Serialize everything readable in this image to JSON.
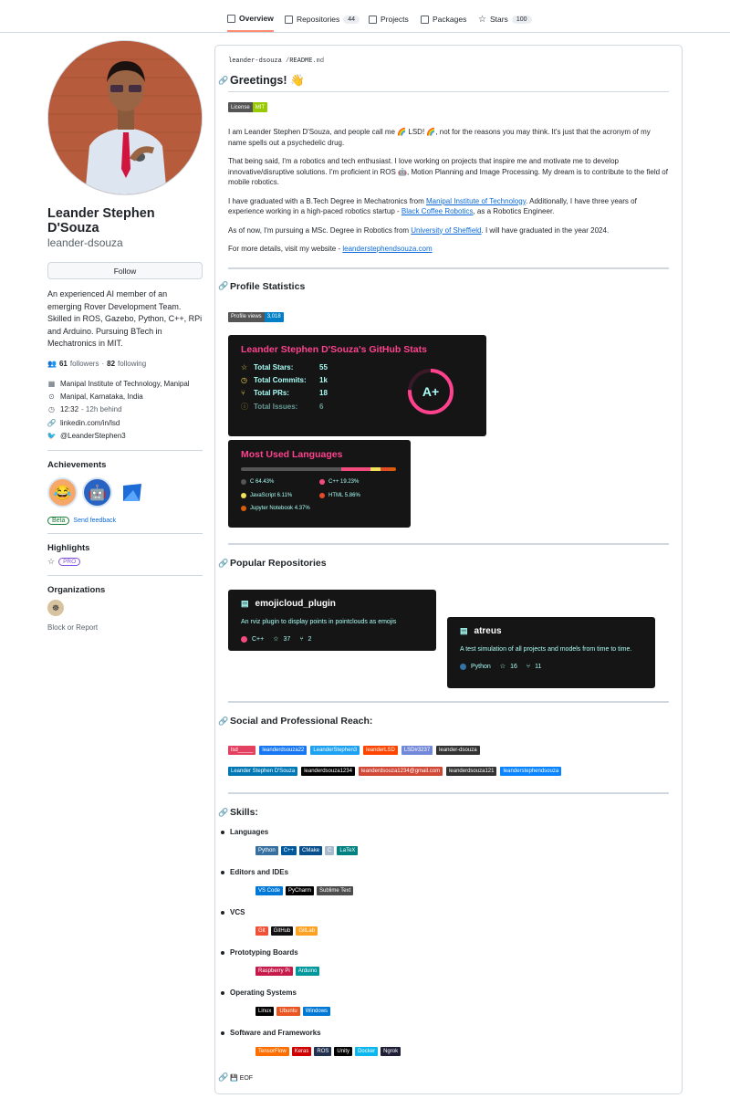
{
  "nav": {
    "tabs": [
      {
        "label": "Overview",
        "icon": "book-icon"
      },
      {
        "label": "Repositories",
        "count": "44",
        "icon": "repo-icon"
      },
      {
        "label": "Projects",
        "icon": "table-icon"
      },
      {
        "label": "Packages",
        "icon": "package-icon"
      },
      {
        "label": "Stars",
        "count": "100",
        "icon": "star-icon"
      }
    ]
  },
  "profile": {
    "name": "Leander Stephen D'Souza",
    "login": "leander-dsouza",
    "follow_label": "Follow",
    "bio": "An experienced AI member of an emerging Rover Development Team. Skilled in ROS, Gazebo, Python, C++, RPi and Arduino. Pursuing BTech in Mechatronics in MIT.",
    "followers": "61",
    "followers_label": "followers",
    "following": "82",
    "following_label": "following",
    "separator": "·",
    "org": "Manipal Institute of Technology, Manipal",
    "location": "Manipal, Karnataka, India",
    "time": "12:32",
    "time_note": "- 12h behind",
    "website": "linkedin.com/in/lsd",
    "twitter": "@LeanderStephen3",
    "achievements_title": "Achievements",
    "beta_label": "Beta",
    "feedback_label": "Send feedback",
    "highlights_title": "Highlights",
    "pro_label": "PRO",
    "orgs_title": "Organizations",
    "block_label": "Block or Report"
  },
  "readme": {
    "path_user": "leander-dsouza",
    "path_sep": "/",
    "path_file": "README",
    "path_ext": ".md",
    "greeting": "Greetings! 👋",
    "license_left": "License",
    "license_right": "MIT",
    "p1": "I am Leander Stephen D'Souza, and people call me 🌈 LSD! 🌈, not for the reasons you may think. It's just that the acronym of my name spells out a psychedelic drug.",
    "p2": "That being said, I'm a robotics and tech enthusiast. I love working on projects that inspire me and motivate me to develop innovative/disruptive solutions. I'm proficient in ROS 🤖, Motion Planning and Image Processing. My dream is to contribute to the field of mobile robotics.",
    "p3_a": "I have graduated with a B.Tech Degree in Mechatronics from ",
    "p3_link1": "Manipal Institute of Technology",
    "p3_b": ". Additionally, I have three years of experience working in a high-paced robotics startup - ",
    "p3_link2": "Black Coffee Robotics",
    "p3_c": ", as a Robotics Engineer.",
    "p4_a": "As of now, I'm pursuing a MSc. Degree in Robotics from ",
    "p4_link": "University of Sheffield",
    "p4_b": ". I will have graduated in the year 2024.",
    "p5_a": "For more details, visit my website - ",
    "p5_link": "leanderstephendsouza.com",
    "stats_heading": "Profile Statistics",
    "views_left": "Profile views",
    "views_right": "3,018",
    "stats_card": {
      "title": "Leander Stephen D'Souza's GitHub Stats",
      "rows": [
        {
          "label": "Total Stars:",
          "value": "55"
        },
        {
          "label": "Total Commits:",
          "value": "1k"
        },
        {
          "label": "Total PRs:",
          "value": "18"
        },
        {
          "label": "Total Issues:",
          "value": "6"
        }
      ],
      "grade": "A+"
    },
    "lang_card": {
      "title": "Most Used Languages",
      "langs": [
        {
          "name": "C 64.43%",
          "color": "#555555",
          "pct": 64.43
        },
        {
          "name": "C++ 19.23%",
          "color": "#f34b7d",
          "pct": 19.23
        },
        {
          "name": "JavaScript 6.11%",
          "color": "#f1e05a",
          "pct": 6.11
        },
        {
          "name": "HTML 5.86%",
          "color": "#e34c26",
          "pct": 5.86
        },
        {
          "name": "Jupyter Notebook 4.37%",
          "color": "#DA5B0B",
          "pct": 4.37
        }
      ]
    },
    "repos_heading": "Popular Repositories",
    "repos": [
      {
        "name": "emojicloud_plugin",
        "desc": "An rviz plugin to display points in pointclouds as emojis",
        "lang": "C++",
        "lang_color": "#f34b7d",
        "stars": "37",
        "forks": "2"
      },
      {
        "name": "atreus",
        "desc": "A test simulation of all projects and models from time to time.",
        "lang": "Python",
        "lang_color": "#3572A5",
        "stars": "16",
        "forks": "11"
      }
    ],
    "social_heading": "Social and Professional Reach:",
    "social_row1": [
      {
        "label": "lsd_____",
        "color": "#E4405F"
      },
      {
        "label": "leanderdsouza22",
        "color": "#1877F2"
      },
      {
        "label": "LeanderStephen3",
        "color": "#1DA1F2"
      },
      {
        "label": "leanderLSD",
        "color": "#FF4500"
      },
      {
        "label": "LSD#3237",
        "color": "#7289DA"
      },
      {
        "label": "leander-dsouza",
        "color": "#333333"
      }
    ],
    "social_row2": [
      {
        "label": "Leander Stephen D'Souza",
        "color": "#0077B5"
      },
      {
        "label": "leanderdsouza1234",
        "color": "#000000"
      },
      {
        "label": "leanderdsouza1234@gmail.com",
        "color": "#D14836"
      },
      {
        "label": "leanderdsouza121",
        "color": "#333333"
      },
      {
        "label": "leanderstephendsouza",
        "color": "#0a84ff"
      }
    ],
    "skills_heading": "Skills:",
    "skills": [
      {
        "title": "Languages",
        "badges": [
          {
            "label": "Python",
            "color": "#3670A0"
          },
          {
            "label": "C++",
            "color": "#00599C"
          },
          {
            "label": "CMake",
            "color": "#064F8C"
          },
          {
            "label": "C",
            "color": "#A8B9CC"
          },
          {
            "label": "LaTeX",
            "color": "#008080"
          }
        ]
      },
      {
        "title": "Editors and IDEs",
        "badges": [
          {
            "label": "VS Code",
            "color": "#0078d7"
          },
          {
            "label": "PyCharm",
            "color": "#000000"
          },
          {
            "label": "Sublime Text",
            "color": "#4c4c4c"
          }
        ]
      },
      {
        "title": "VCS",
        "badges": [
          {
            "label": "Git",
            "color": "#F05033"
          },
          {
            "label": "GitHub",
            "color": "#121011"
          },
          {
            "label": "GitLab",
            "color": "#FCA121"
          }
        ]
      },
      {
        "title": "Prototyping Boards",
        "badges": [
          {
            "label": "Raspberry Pi",
            "color": "#C51A4A"
          },
          {
            "label": "Arduino",
            "color": "#00979D"
          }
        ]
      },
      {
        "title": "Operating Systems",
        "badges": [
          {
            "label": "Linux",
            "color": "#000000"
          },
          {
            "label": "Ubuntu",
            "color": "#E95420"
          },
          {
            "label": "Windows",
            "color": "#0078D6"
          }
        ]
      },
      {
        "title": "Software and Frameworks",
        "badges": [
          {
            "label": "TensorFlow",
            "color": "#FF6F00"
          },
          {
            "label": "Keras",
            "color": "#D00000"
          },
          {
            "label": "ROS",
            "color": "#22314E"
          },
          {
            "label": "Unity",
            "color": "#000000"
          },
          {
            "label": "Docker",
            "color": "#0db7ed"
          },
          {
            "label": "Ngrok",
            "color": "#1F1E37"
          }
        ]
      }
    ],
    "eof": "💾 EOF"
  }
}
